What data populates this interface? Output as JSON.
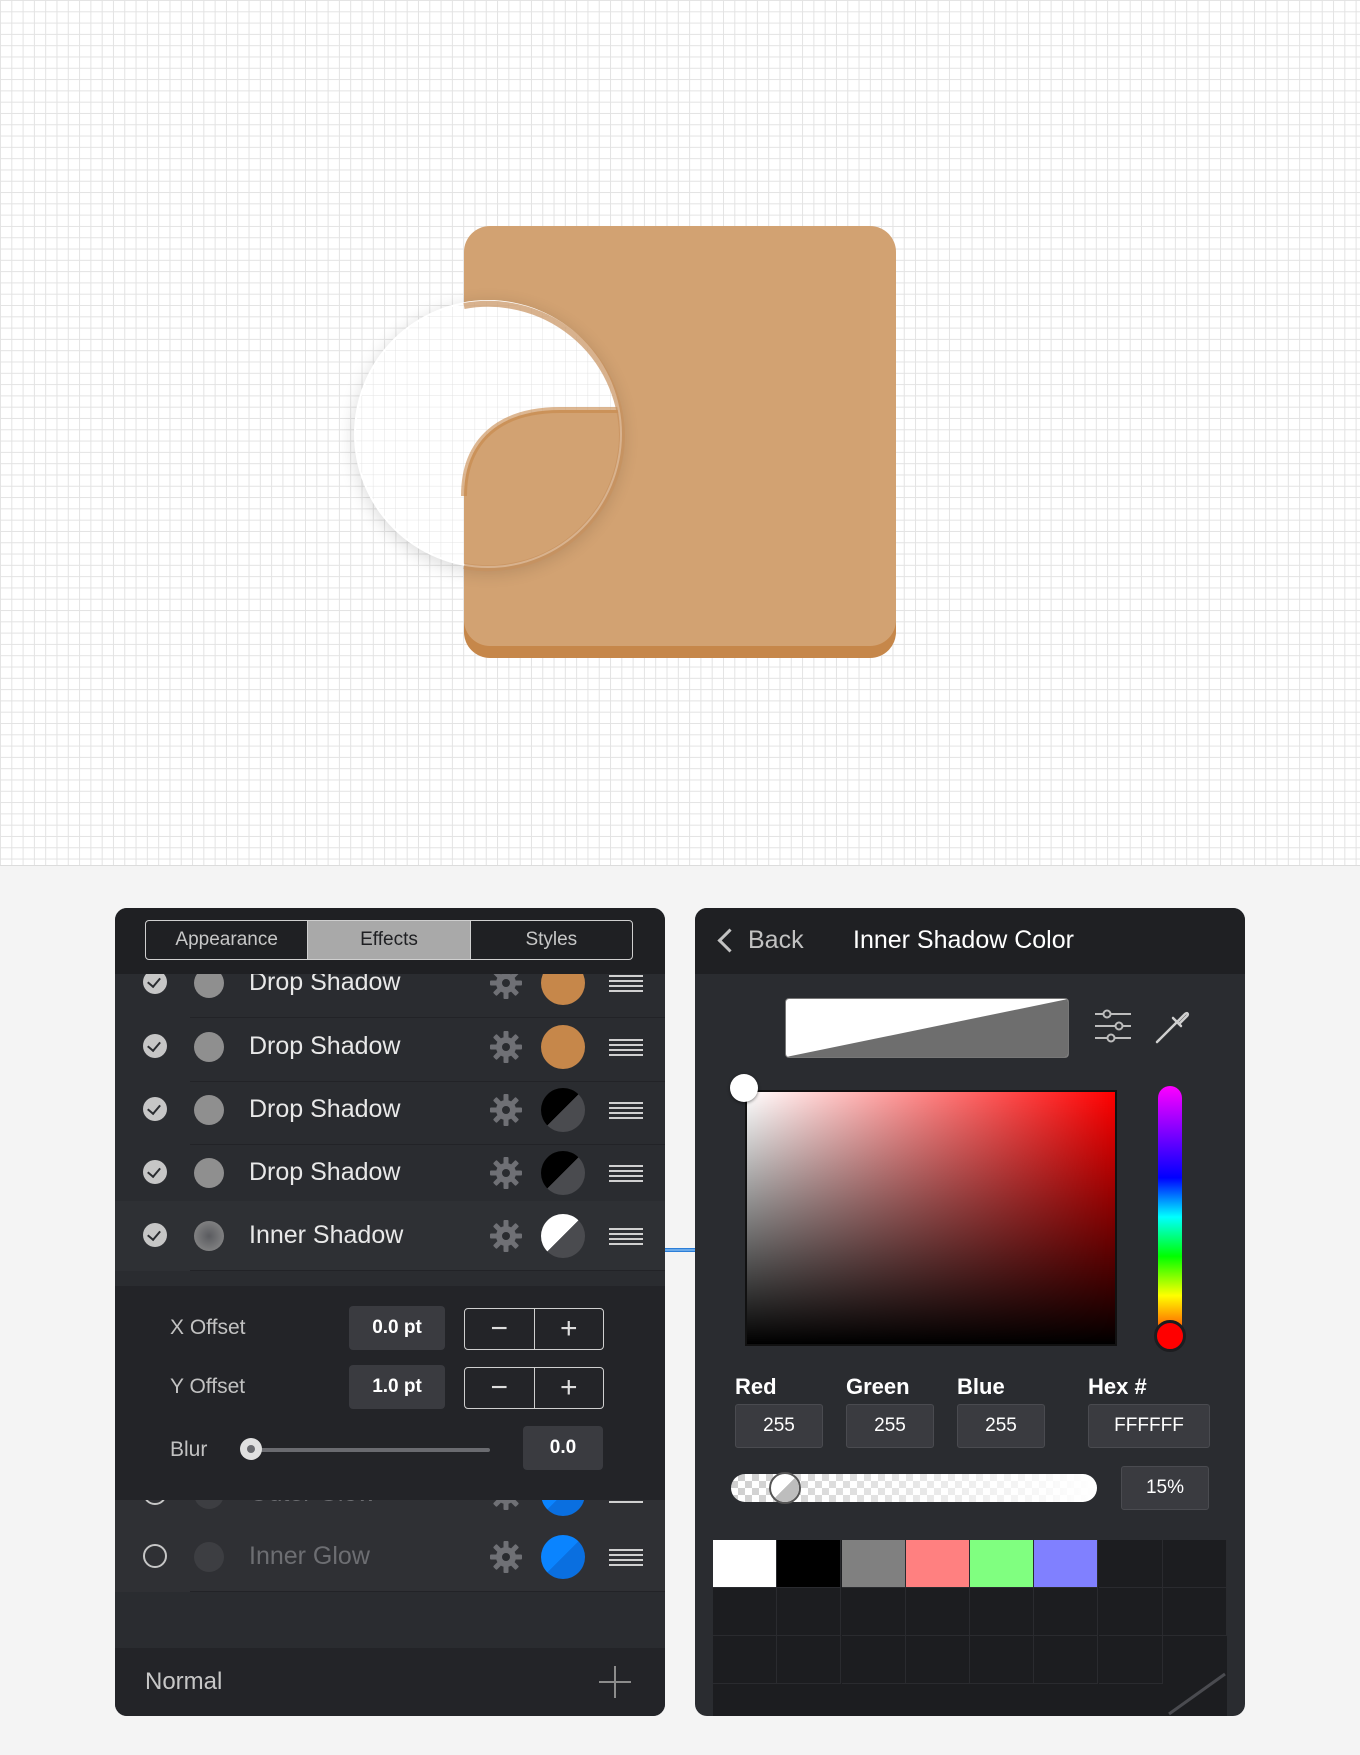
{
  "canvas": {
    "colors": {
      "tan": "#d2a272",
      "tan_dark": "#c6874a",
      "grid": "#e3e3e3"
    }
  },
  "layers_panel": {
    "tabs": [
      {
        "label": "Appearance",
        "active": false
      },
      {
        "label": "Effects",
        "active": true
      },
      {
        "label": "Styles",
        "active": false
      }
    ],
    "effects": [
      {
        "label": "Drop Shadow",
        "enabled": true,
        "swatch": "#c6874a",
        "partial": true
      },
      {
        "label": "Drop Shadow",
        "enabled": true,
        "swatch": "#c6874a"
      },
      {
        "label": "Drop Shadow",
        "enabled": true,
        "swatch": "black-half"
      },
      {
        "label": "Drop Shadow",
        "enabled": true,
        "swatch": "black-half"
      },
      {
        "label": "Inner Shadow",
        "enabled": true,
        "swatch": "white-half"
      },
      {
        "label": "Outer Glow",
        "enabled": false,
        "swatch": "#0a84ff"
      },
      {
        "label": "Inner Glow",
        "enabled": false,
        "swatch": "#0a84ff"
      }
    ],
    "details": {
      "x_offset_label": "X Offset",
      "x_offset_value": "0.0 pt",
      "y_offset_label": "Y Offset",
      "y_offset_value": "1.0 pt",
      "blur_label": "Blur",
      "blur_value": "0.0",
      "stepper_minus": "−",
      "stepper_plus": "+"
    },
    "blend_mode": "Normal"
  },
  "color_panel": {
    "back_label": "Back",
    "title": "Inner Shadow Color",
    "red_label": "Red",
    "green_label": "Green",
    "blue_label": "Blue",
    "hex_label": "Hex #",
    "red": "255",
    "green": "255",
    "blue": "255",
    "hex": "FFFFFF",
    "opacity": "15%",
    "hue_color": "#ff0000",
    "palette": [
      "#ffffff",
      "#000000",
      "#808080",
      "#ff8080",
      "#80ff80",
      "#8080ff"
    ]
  }
}
